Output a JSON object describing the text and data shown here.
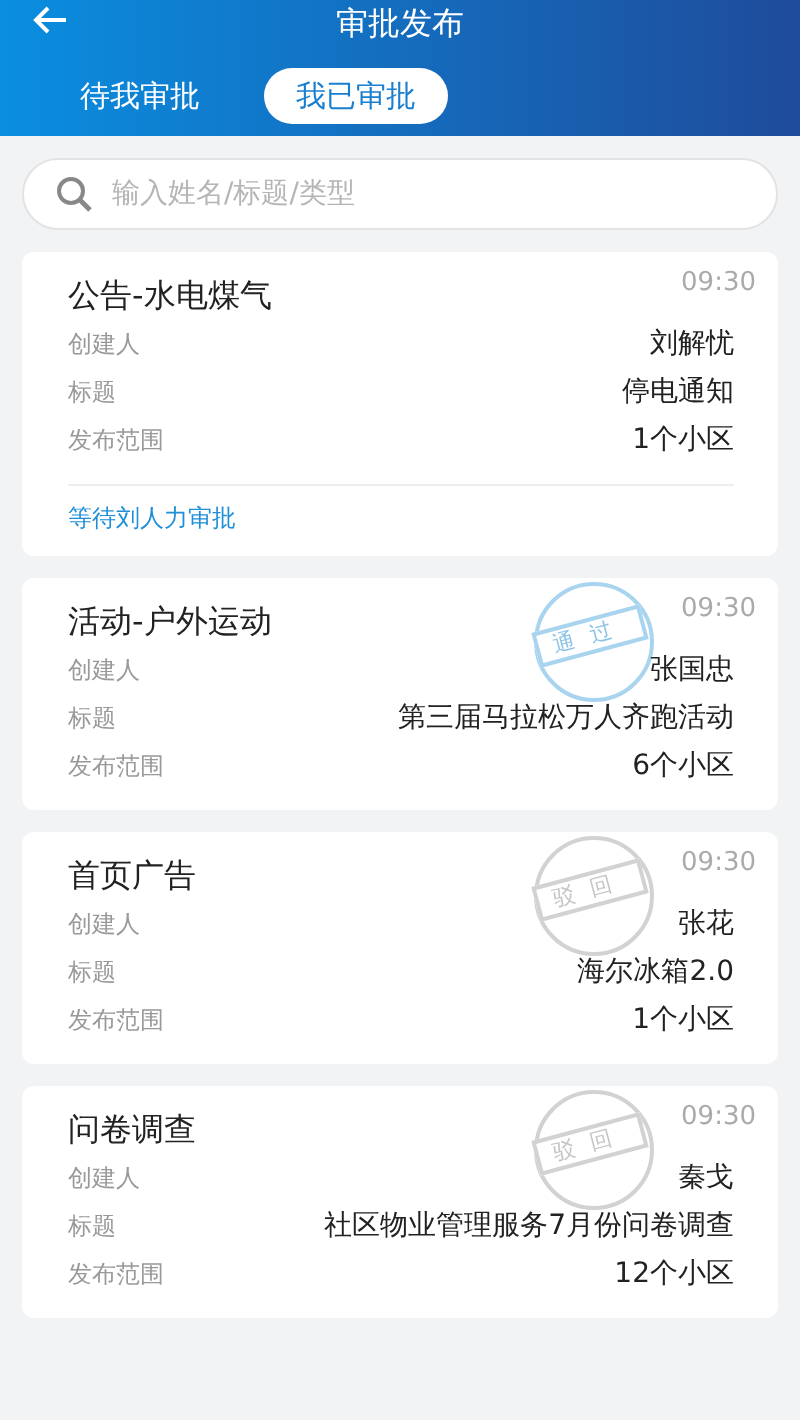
{
  "header": {
    "title": "审批发布"
  },
  "tabs": [
    {
      "label": "待我审批",
      "selected": false
    },
    {
      "label": "我已审批",
      "selected": true
    }
  ],
  "search": {
    "placeholder": "输入姓名/标题/类型"
  },
  "items": [
    {
      "title": "公告-水电煤气",
      "time": "09:30",
      "fields": [
        {
          "label": "创建人",
          "value": "刘解忧"
        },
        {
          "label": "标题",
          "value": "停电通知"
        },
        {
          "label": "发布范围",
          "value": "1个小区"
        }
      ],
      "pending": "等待刘人力审批"
    },
    {
      "title": "活动-户外运动",
      "time": "09:30",
      "stamp": {
        "kind": "approved",
        "text": "通过"
      },
      "fields": [
        {
          "label": "创建人",
          "value": "张国忠"
        },
        {
          "label": "标题",
          "value": "第三届马拉松万人齐跑活动"
        },
        {
          "label": "发布范围",
          "value": "6个小区"
        }
      ]
    },
    {
      "title": "首页广告",
      "time": "09:30",
      "stamp": {
        "kind": "rejected",
        "text": "驳回"
      },
      "fields": [
        {
          "label": "创建人",
          "value": "张花"
        },
        {
          "label": "标题",
          "value": "海尔冰箱2.0"
        },
        {
          "label": "发布范围",
          "value": "1个小区"
        }
      ]
    },
    {
      "title": "问卷调查",
      "time": "09:30",
      "stamp": {
        "kind": "rejected",
        "text": "驳回"
      },
      "fields": [
        {
          "label": "创建人",
          "value": "秦戈"
        },
        {
          "label": "标题",
          "value": "社区物业管理服务7月份问卷调查"
        },
        {
          "label": "发布范围",
          "value": "12个小区"
        }
      ]
    }
  ]
}
